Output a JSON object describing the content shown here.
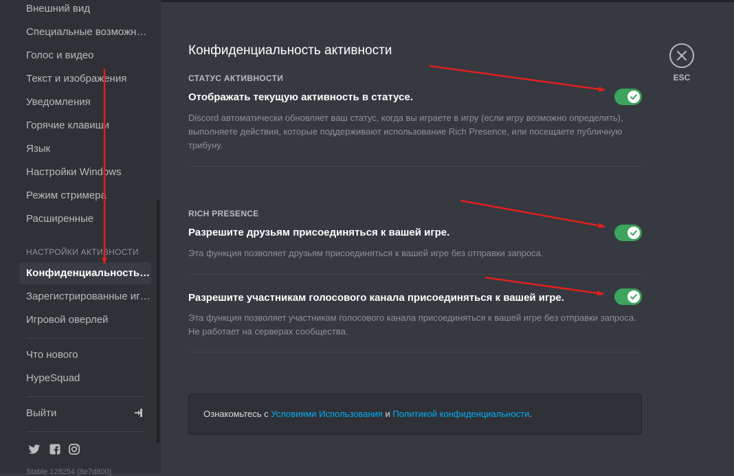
{
  "sidebar": {
    "items_top": [
      "Внешний вид",
      "Специальные возможности",
      "Голос и видео",
      "Текст и изображения",
      "Уведомления",
      "Горячие клавиши",
      "Язык",
      "Настройки Windows",
      "Режим стримера",
      "Расширенные"
    ],
    "activity_header": "НАСТРОЙКИ АКТИВНОСТИ",
    "activity_items": [
      "Конфиденциальность активности",
      "Зарегистрированные игры",
      "Игровой оверлей"
    ],
    "misc_items": [
      "Что нового",
      "HypeSquad"
    ],
    "logout_label": "Выйти",
    "social_icons": [
      "twitter-icon",
      "facebook-icon",
      "instagram-icon"
    ],
    "version": "Stable 128254 (8e7d800)"
  },
  "main": {
    "title": "Конфиденциальность активности",
    "status_section": {
      "header": "СТАТУС АКТИВНОСТИ",
      "option_title": "Отображать текущую активность в статусе.",
      "option_desc": "Discord автоматически обновляет ваш статус, когда вы играете в игру (если игру возможно определить), выполняете действия, которые поддерживают использование Rich Presence, или посещаете публичную трибуну.",
      "enabled": true
    },
    "rich_presence": {
      "header": "RICH PRESENCE",
      "friends_title": "Разрешите друзьям присоединяться к вашей игре.",
      "friends_desc": "Эта функция позволяет друзьям присоединяться к вашей игре без отправки запроса.",
      "friends_enabled": true,
      "voice_title": "Разрешите участникам голосового канала присоединяться к вашей игре.",
      "voice_desc": "Эта функция позволяет участникам голосового канала присоединяться к вашей игре без отправки запроса. Не работает на серверах сообщества.",
      "voice_enabled": true
    },
    "footer": {
      "prefix": "Ознакомьтесь с ",
      "terms_link": "Условиями Использования",
      "conjunction": " и ",
      "privacy_link": "Политикой конфиденциальности",
      "suffix": "."
    }
  },
  "close": {
    "label": "ESC"
  },
  "colors": {
    "background": "#36393f",
    "sidebar": "#2f3136",
    "toggle_on": "#3ba55d",
    "link": "#00aff4",
    "annotation_arrow": "#e02020"
  }
}
